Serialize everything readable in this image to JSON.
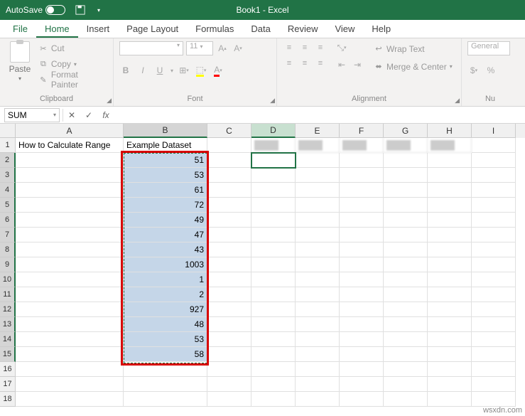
{
  "titlebar": {
    "autosave_label": "AutoSave",
    "doc_title": "Book1 - Excel"
  },
  "menu": {
    "file": "File",
    "home": "Home",
    "insert": "Insert",
    "page_layout": "Page Layout",
    "formulas": "Formulas",
    "data": "Data",
    "review": "Review",
    "view": "View",
    "help": "Help"
  },
  "ribbon": {
    "clipboard": {
      "label": "Clipboard",
      "paste": "Paste",
      "cut": "Cut",
      "copy": "Copy",
      "format_painter": "Format Painter"
    },
    "font": {
      "label": "Font",
      "name_placeholder": "",
      "size": "11",
      "bold": "B",
      "italic": "I",
      "underline": "U"
    },
    "alignment": {
      "label": "Alignment",
      "wrap": "Wrap Text",
      "merge": "Merge & Center"
    },
    "number": {
      "label": "Nu",
      "format": "General"
    }
  },
  "formula_bar": {
    "name_box": "SUM",
    "fx": "fx",
    "formula_blur": "                                                                      "
  },
  "columns": [
    "A",
    "B",
    "C",
    "D",
    "E",
    "F",
    "G",
    "H",
    "I"
  ],
  "row_headers": [
    "1",
    "2",
    "3",
    "4",
    "5",
    "6",
    "7",
    "8",
    "9",
    "10",
    "11",
    "12",
    "13",
    "14",
    "15",
    "16",
    "17",
    "18"
  ],
  "cells": {
    "A1": "How to Calculate Range",
    "B1": "Example Dataset",
    "B2": "51",
    "B3": "53",
    "B4": "61",
    "B5": "72",
    "B6": "49",
    "B7": "47",
    "B8": "43",
    "B9": "1003",
    "B10": "1",
    "B11": "2",
    "B12": "927",
    "B13": "48",
    "B14": "53",
    "B15": "58"
  },
  "active_cell": "D2",
  "watermark": "wsxdn.com"
}
